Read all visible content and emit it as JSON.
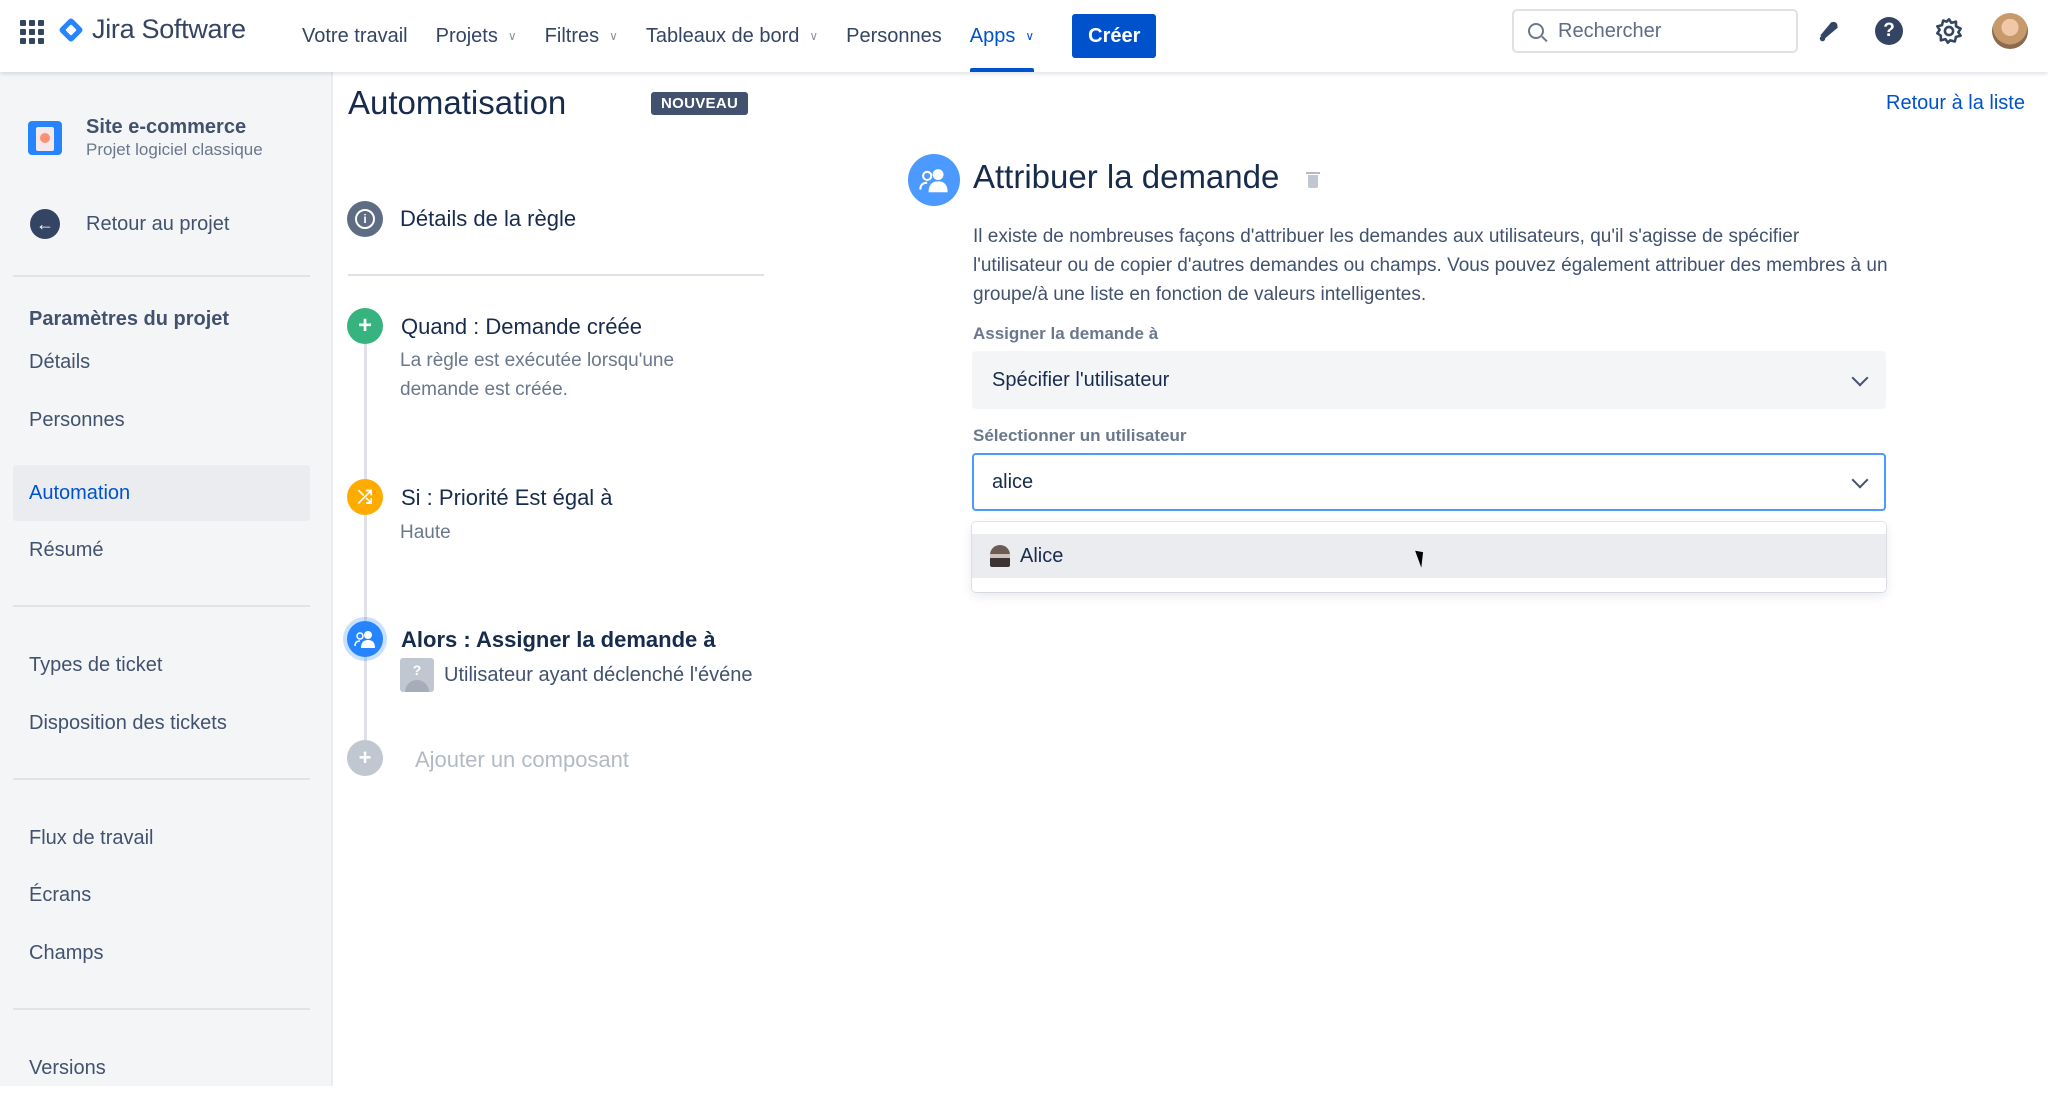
{
  "topnav": {
    "product": "Jira Software",
    "items": [
      {
        "label": "Votre travail",
        "dropdown": false,
        "active": false
      },
      {
        "label": "Projets",
        "dropdown": true,
        "active": false
      },
      {
        "label": "Filtres",
        "dropdown": true,
        "active": false
      },
      {
        "label": "Tableaux de bord",
        "dropdown": true,
        "active": false
      },
      {
        "label": "Personnes",
        "dropdown": false,
        "active": false
      },
      {
        "label": "Apps",
        "dropdown": true,
        "active": true
      }
    ],
    "create_label": "Créer",
    "search_placeholder": "Rechercher",
    "icons": [
      "notifications-icon",
      "help-icon",
      "settings-icon",
      "profile-avatar"
    ],
    "accent_color": "#0052cc"
  },
  "sidebar": {
    "project_name": "Site e-commerce",
    "project_type": "Projet logiciel classique",
    "back_label": "Retour au projet",
    "section_heading": "Paramètres du projet",
    "items": [
      {
        "label": "Détails",
        "active": false
      },
      {
        "label": "Personnes",
        "active": false
      },
      {
        "label": "Automation",
        "active": true
      },
      {
        "label": "Résumé",
        "active": false
      },
      {
        "label": "Types de ticket",
        "active": false
      },
      {
        "label": "Disposition des tickets",
        "active": false
      },
      {
        "label": "Flux de travail",
        "active": false
      },
      {
        "label": "Écrans",
        "active": false
      },
      {
        "label": "Champs",
        "active": false
      },
      {
        "label": "Versions",
        "active": false
      }
    ]
  },
  "rule": {
    "page_title": "Automatisation",
    "badge": "NOUVEAU",
    "details_label": "Détails de la règle",
    "trigger": {
      "title": "Quand : Demande créée",
      "description": "La règle est exécutée lorsqu'une demande est créée.",
      "color": "#36b37e"
    },
    "condition": {
      "title": "Si : Priorité Est égal à",
      "value": "Haute",
      "color": "#ffab00"
    },
    "action": {
      "title": "Alors : Assigner la demande à",
      "user": "Utilisateur ayant déclenché l'événe",
      "color": "#2684ff"
    },
    "add_component": "Ajouter un composant"
  },
  "panel": {
    "back_to_list": "Retour à la liste",
    "title": "Attribuer la demande",
    "description": "Il existe de nombreuses façons d'attribuer les demandes aux utilisateurs, qu'il s'agisse de spécifier l'utilisateur ou de copier d'autres demandes ou champs. Vous pouvez également attribuer des membres à un groupe/à une liste en fonction de valeurs intelligentes.",
    "assign_label": "Assigner la demande à",
    "assign_value": "Spécifier l'utilisateur",
    "user_label": "Sélectionner un utilisateur",
    "user_input_value": "alice",
    "options": [
      {
        "label": "Alice"
      }
    ]
  }
}
